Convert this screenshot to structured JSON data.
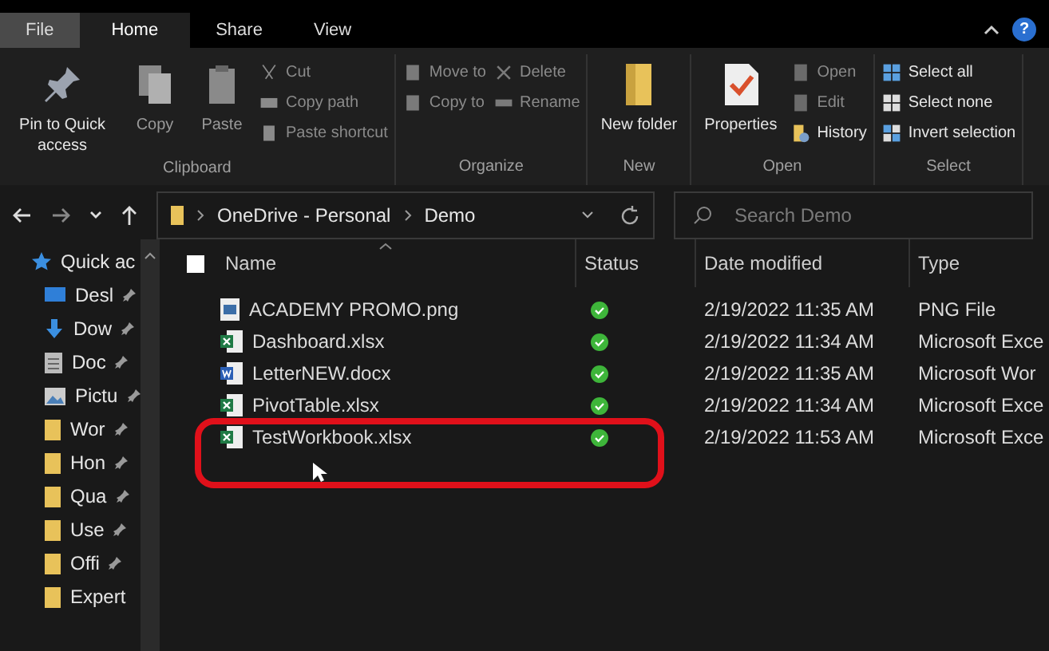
{
  "tabs": [
    {
      "label": "File",
      "kind": "file",
      "selected": false
    },
    {
      "label": "Home",
      "kind": "tab",
      "selected": true
    },
    {
      "label": "Share",
      "kind": "tab",
      "selected": false
    },
    {
      "label": "View",
      "kind": "tab",
      "selected": false
    }
  ],
  "help": "?",
  "ribbon": {
    "groups": [
      {
        "label": "Clipboard",
        "items": [
          {
            "label": "Pin to Quick access",
            "kind": "large",
            "disabled": false
          },
          {
            "label": "Copy",
            "kind": "large",
            "disabled": true
          },
          {
            "label": "Paste",
            "kind": "large",
            "disabled": true
          },
          {
            "label": "Cut",
            "kind": "small",
            "disabled": true
          },
          {
            "label": "Copy path",
            "kind": "small",
            "disabled": true
          },
          {
            "label": "Paste shortcut",
            "kind": "small",
            "disabled": true
          }
        ]
      },
      {
        "label": "Organize",
        "items": [
          {
            "label": "Move to",
            "kind": "small",
            "disabled": true
          },
          {
            "label": "Copy to",
            "kind": "small",
            "disabled": true
          },
          {
            "label": "Delete",
            "kind": "small",
            "disabled": true
          },
          {
            "label": "Rename",
            "kind": "small",
            "disabled": true
          }
        ]
      },
      {
        "label": "New",
        "items": [
          {
            "label": "New folder",
            "kind": "large",
            "disabled": false
          }
        ]
      },
      {
        "label": "Open",
        "items": [
          {
            "label": "Properties",
            "kind": "large",
            "disabled": false
          },
          {
            "label": "Open",
            "kind": "small",
            "disabled": true
          },
          {
            "label": "Edit",
            "kind": "small",
            "disabled": true
          },
          {
            "label": "History",
            "kind": "small",
            "disabled": false
          }
        ]
      },
      {
        "label": "Select",
        "items": [
          {
            "label": "Select all",
            "kind": "small",
            "disabled": false
          },
          {
            "label": "Select none",
            "kind": "small",
            "disabled": false
          },
          {
            "label": "Invert selection",
            "kind": "small",
            "disabled": false
          }
        ]
      }
    ]
  },
  "breadcrumb": [
    "OneDrive - Personal",
    "Demo"
  ],
  "search": {
    "placeholder": "Search Demo"
  },
  "nav": [
    {
      "label": "Quick ac",
      "kind": "star"
    },
    {
      "label": "Desl",
      "kind": "desktop"
    },
    {
      "label": "Dow",
      "kind": "download"
    },
    {
      "label": "Doc",
      "kind": "document"
    },
    {
      "label": "Pictu",
      "kind": "picture"
    },
    {
      "label": "Wor",
      "kind": "folder"
    },
    {
      "label": "Hon",
      "kind": "folder"
    },
    {
      "label": "Qua",
      "kind": "folder"
    },
    {
      "label": "Use",
      "kind": "folder"
    },
    {
      "label": "Offi",
      "kind": "folder"
    },
    {
      "label": "Expert",
      "kind": "folder"
    }
  ],
  "select_all": {
    "checked": false
  },
  "columns": [
    "Name",
    "Status",
    "Date modified",
    "Type"
  ],
  "rows": [
    {
      "name": "ACADEMY PROMO.png",
      "kind": "image",
      "date": "2/19/2022 11:35 AM",
      "type": "PNG File"
    },
    {
      "name": "Dashboard.xlsx",
      "kind": "excel",
      "date": "2/19/2022 11:34 AM",
      "type": "Microsoft Exce"
    },
    {
      "name": "LetterNEW.docx",
      "kind": "word",
      "date": "2/19/2022 11:35 AM",
      "type": "Microsoft Wor"
    },
    {
      "name": "PivotTable.xlsx",
      "kind": "excel",
      "date": "2/19/2022 11:34 AM",
      "type": "Microsoft Exce"
    },
    {
      "name": "TestWorkbook.xlsx",
      "kind": "excel",
      "date": "2/19/2022 11:53 AM",
      "type": "Microsoft Exce"
    }
  ]
}
